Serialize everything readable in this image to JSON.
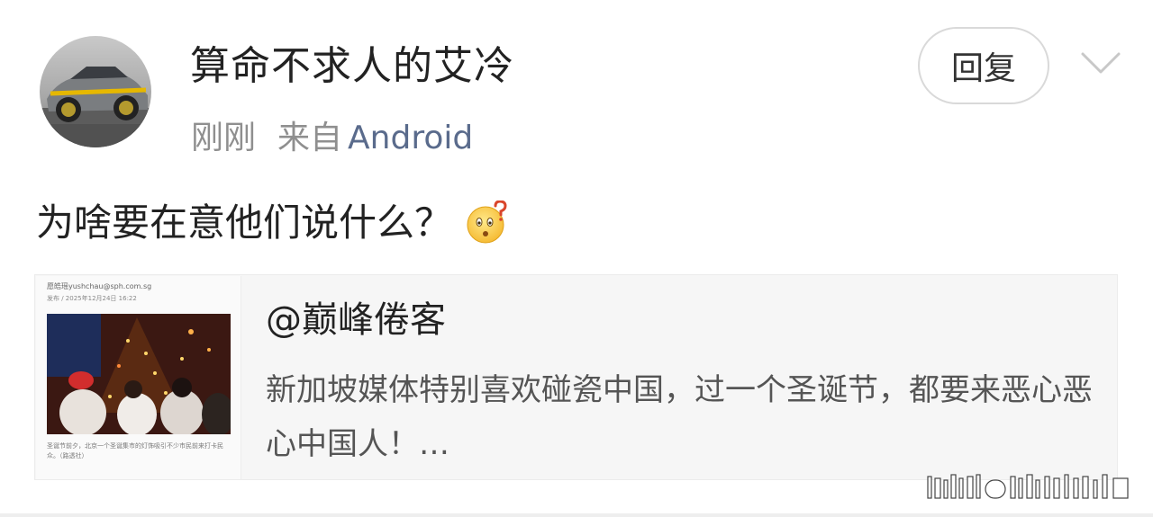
{
  "post": {
    "username": "算命不求人的艾冷",
    "time": "刚刚",
    "from_label": "来自",
    "source": "Android",
    "reply_label": "回复",
    "text": "为啥要在意他们说什么？"
  },
  "repost_card": {
    "title": "@巅峰倦客",
    "description": "新加坡媒体特别喜欢碰瓷中国，过一个圣诞节，都要来恶心恶心中国人！…"
  },
  "thumbnail": {
    "byline": "愿皓瑶yushchau@sph.com.sg",
    "date_line": "发布 / 2025年12月24日 16:22",
    "caption": "圣诞节前夕，北京一个圣诞集市的灯饰吸引不少市民前来打卡民众。（路透社）"
  },
  "icons": {
    "chevron": "chevron-down-icon",
    "emoji": "thinking-question-emoji-icon",
    "avatar": "car-avatar-image"
  },
  "colors": {
    "username": "#222222",
    "meta_gray": "#8f8f8f",
    "source_link": "#5a6b8c",
    "card_bg": "#f6f6f6"
  }
}
